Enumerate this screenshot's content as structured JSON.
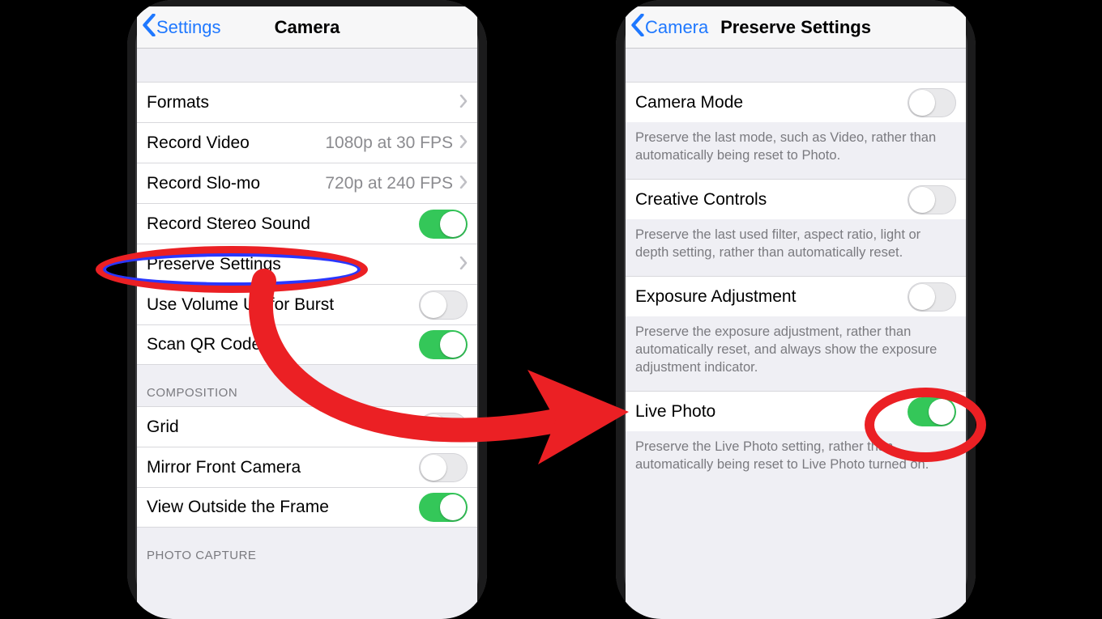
{
  "colors": {
    "accent_blue": "#1f78ff",
    "toggle_green": "#34c759",
    "annotation_red": "#eb2024"
  },
  "left": {
    "back_label": "Settings",
    "title": "Camera",
    "rows": {
      "formats": {
        "label": "Formats"
      },
      "record_video": {
        "label": "Record Video",
        "value": "1080p at 30 FPS"
      },
      "record_slomo": {
        "label": "Record Slo-mo",
        "value": "720p at 240 FPS"
      },
      "stereo_sound": {
        "label": "Record Stereo Sound",
        "on": true
      },
      "preserve": {
        "label": "Preserve Settings"
      },
      "volume_burst": {
        "label": "Use Volume Up for Burst",
        "on": false
      },
      "scan_qr": {
        "label": "Scan QR Codes",
        "on": true
      }
    },
    "headers": {
      "composition": "COMPOSITION",
      "photo_capture": "PHOTO CAPTURE"
    },
    "composition": {
      "grid": {
        "label": "Grid",
        "on": false
      },
      "mirror_front": {
        "label": "Mirror Front Camera",
        "on": false
      },
      "view_outside": {
        "label": "View Outside the Frame",
        "on": true
      }
    }
  },
  "right": {
    "back_label": "Camera",
    "title": "Preserve Settings",
    "items": {
      "camera_mode": {
        "label": "Camera Mode",
        "on": false,
        "note": "Preserve the last mode, such as Video, rather than automatically being reset to Photo."
      },
      "creative_controls": {
        "label": "Creative Controls",
        "on": false,
        "note": "Preserve the last used filter, aspect ratio, light or depth setting, rather than automatically reset."
      },
      "exposure": {
        "label": "Exposure Adjustment",
        "on": false,
        "note": "Preserve the exposure adjustment, rather than automatically reset, and always show the exposure adjustment indicator."
      },
      "live_photo": {
        "label": "Live Photo",
        "on": true,
        "note": "Preserve the Live Photo setting, rather than automatically being reset to Live Photo turned on."
      }
    }
  }
}
